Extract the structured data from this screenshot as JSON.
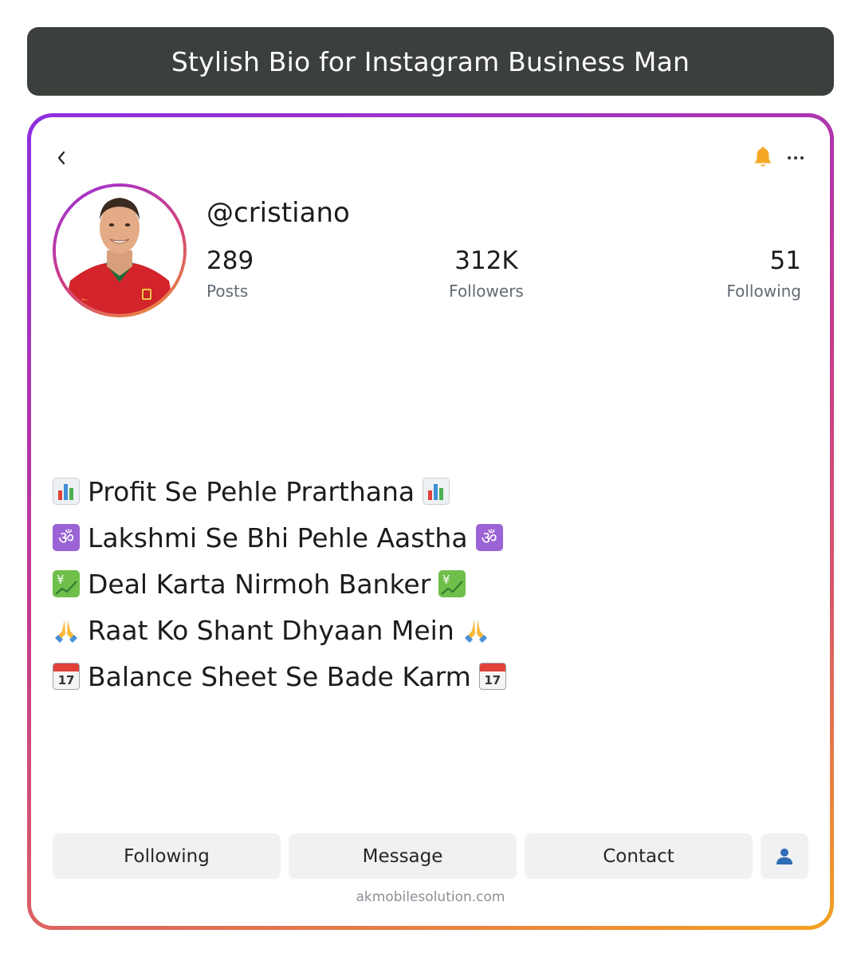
{
  "header": {
    "title": "Stylish Bio for Instagram Business Man"
  },
  "profile": {
    "username": "@cristiano",
    "stats": [
      {
        "value": "289",
        "label": "Posts"
      },
      {
        "value": "312K",
        "label": "Followers"
      },
      {
        "value": "51",
        "label": "Following"
      }
    ]
  },
  "icons": {
    "back": "chevron-left-icon",
    "bell": "bell-icon",
    "more": "more-horizontal-icon",
    "person": "person-icon"
  },
  "bio": {
    "lines": [
      {
        "text": "Profit Se Pehle Prarthana",
        "emoji": "bar-chart-emoji"
      },
      {
        "text": "Lakshmi Se Bhi Pehle Aastha",
        "emoji": "om-emoji"
      },
      {
        "text": "Deal Karta Nirmoh Banker",
        "emoji": "yen-chart-emoji"
      },
      {
        "text": "Raat Ko Shant Dhyaan Mein",
        "emoji": "folded-hands-emoji"
      },
      {
        "text": "Balance Sheet Se Bade Karm",
        "emoji": "calendar-emoji"
      }
    ],
    "calendar_label": "17"
  },
  "actions": {
    "following": "Following",
    "message": "Message",
    "contact": "Contact"
  },
  "footer": {
    "watermark": "akmobilesolution.com"
  },
  "colors": {
    "title_bar": "#3c403c",
    "bell": "#f5a623",
    "gradient_start": "#8d2fe0",
    "gradient_end": "#f3a122",
    "button_bg": "#f0f1f3"
  }
}
